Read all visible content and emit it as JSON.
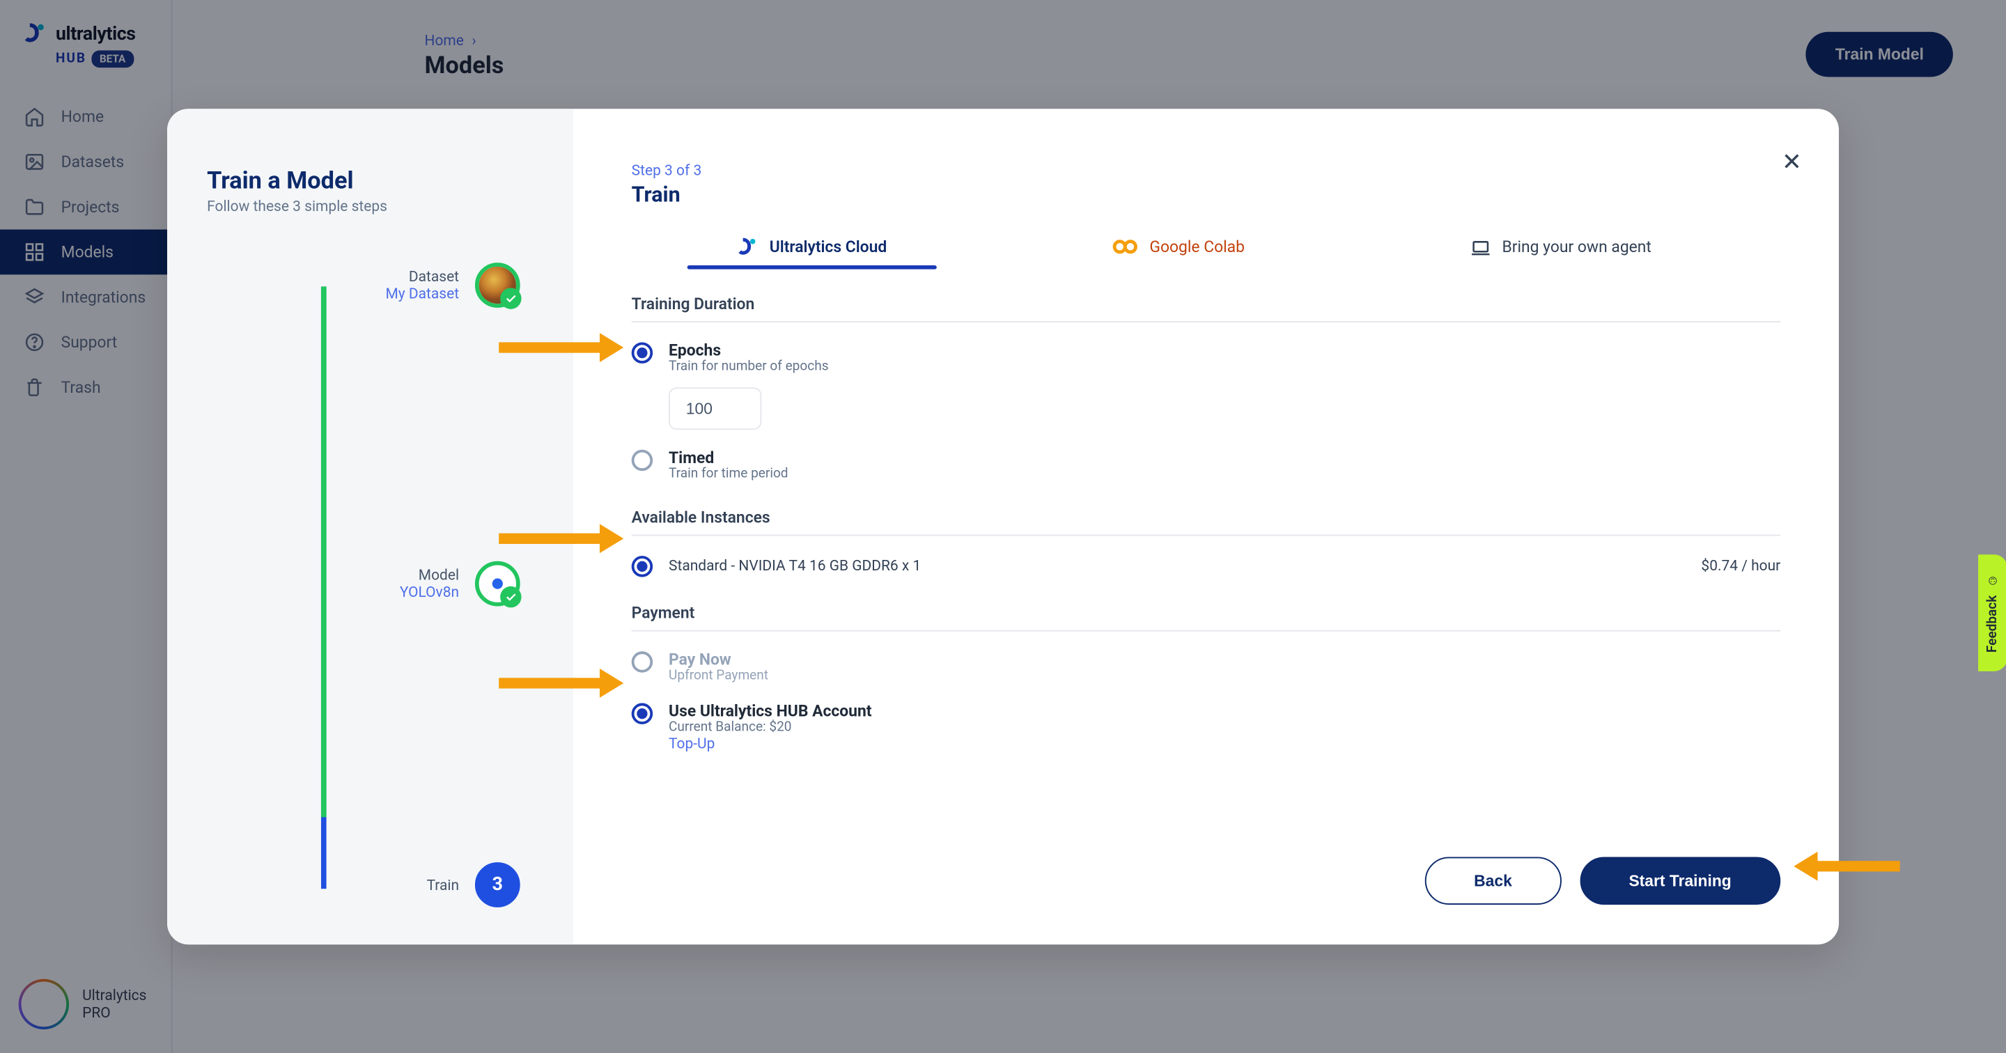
{
  "brand": {
    "name": "ultralytics",
    "hub": "HUB",
    "beta": "BETA"
  },
  "nav": {
    "home": "Home",
    "datasets": "Datasets",
    "projects": "Projects",
    "models": "Models",
    "integrations": "Integrations",
    "support": "Support",
    "trash": "Trash"
  },
  "sidebar_footer": {
    "line1": "Ultralytics",
    "line2": "PRO"
  },
  "page": {
    "breadcrumb_root": "Home",
    "title": "Models",
    "train_button": "Train Model"
  },
  "modal": {
    "left": {
      "title": "Train a Model",
      "subtitle": "Follow these 3 simple steps",
      "steps": {
        "dataset": {
          "label": "Dataset",
          "value": "My Dataset"
        },
        "model": {
          "label": "Model",
          "value": "YOLOv8n"
        },
        "train": {
          "label": "Train",
          "num": "3"
        }
      }
    },
    "right": {
      "step_of": "Step 3 of 3",
      "title": "Train",
      "tabs": {
        "cloud": "Ultralytics Cloud",
        "colab": "Google Colab",
        "agent": "Bring your own agent"
      },
      "sections": {
        "duration": "Training Duration",
        "instances": "Available Instances",
        "payment": "Payment"
      },
      "duration": {
        "epochs_title": "Epochs",
        "epochs_desc": "Train for number of epochs",
        "epochs_value": "100",
        "timed_title": "Timed",
        "timed_desc": "Train for time period"
      },
      "instance": {
        "name": "Standard - NVIDIA T4 16 GB GDDR6 x 1",
        "price": "$0.74 / hour"
      },
      "payment": {
        "paynow_title": "Pay Now",
        "paynow_desc": "Upfront Payment",
        "hub_title": "Use Ultralytics HUB Account",
        "hub_desc": "Current Balance: $20",
        "topup": "Top-Up"
      },
      "footer": {
        "back": "Back",
        "start": "Start Training"
      }
    }
  },
  "feedback": "Feedback"
}
